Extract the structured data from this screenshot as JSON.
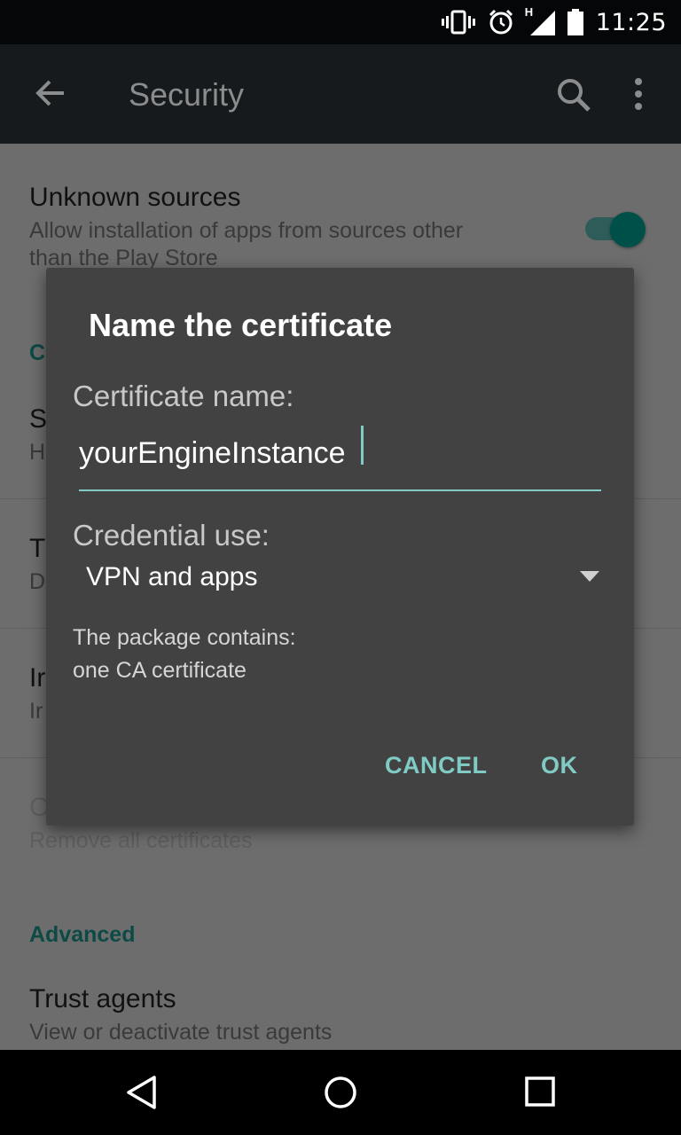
{
  "status_bar": {
    "time": "11:25",
    "icons": [
      "vibrate-icon",
      "alarm-icon",
      "signal-h-icon",
      "battery-icon"
    ],
    "network_label": "H"
  },
  "action_bar": {
    "title": "Security",
    "icons": [
      "back-arrow-icon",
      "search-icon",
      "more-vert-icon"
    ]
  },
  "background": {
    "unknown_sources": {
      "title": "Unknown sources",
      "subtitle_line1": "Allow installation of apps from sources other",
      "subtitle_line2": "than the Play Store",
      "toggle_on": true
    },
    "partial_rows": [
      {
        "title_initial": "C",
        "subtitle_initial": ""
      },
      {
        "title_initial": "S",
        "subtitle_initial": "H"
      },
      {
        "title_initial": "T",
        "subtitle_initial": "D"
      },
      {
        "title_initial": "Ir",
        "subtitle_initial": "Ir"
      },
      {
        "title_initial": "C",
        "subtitle_initial": ""
      }
    ],
    "clear_credentials_subtitle": "Remove all certificates",
    "advanced_header": "Advanced",
    "trust_agents": {
      "title": "Trust agents",
      "subtitle": "View or deactivate trust agents"
    }
  },
  "dialog": {
    "title": "Name the certificate",
    "name_label": "Certificate name:",
    "name_value": "yourEngineInstance",
    "use_label": "Credential use:",
    "use_value": "VPN and apps",
    "info_line1": "The package contains:",
    "info_line2": "one CA certificate",
    "cancel_label": "CANCEL",
    "ok_label": "OK"
  },
  "nav_bar": {
    "icons": [
      "back-triangle-icon",
      "home-circle-icon",
      "recents-square-icon"
    ]
  },
  "colors": {
    "accent": "#80cbc4",
    "dialog_bg": "#424242",
    "scrim_content": "#6d6d6d",
    "toolbar": "#161a1c"
  }
}
